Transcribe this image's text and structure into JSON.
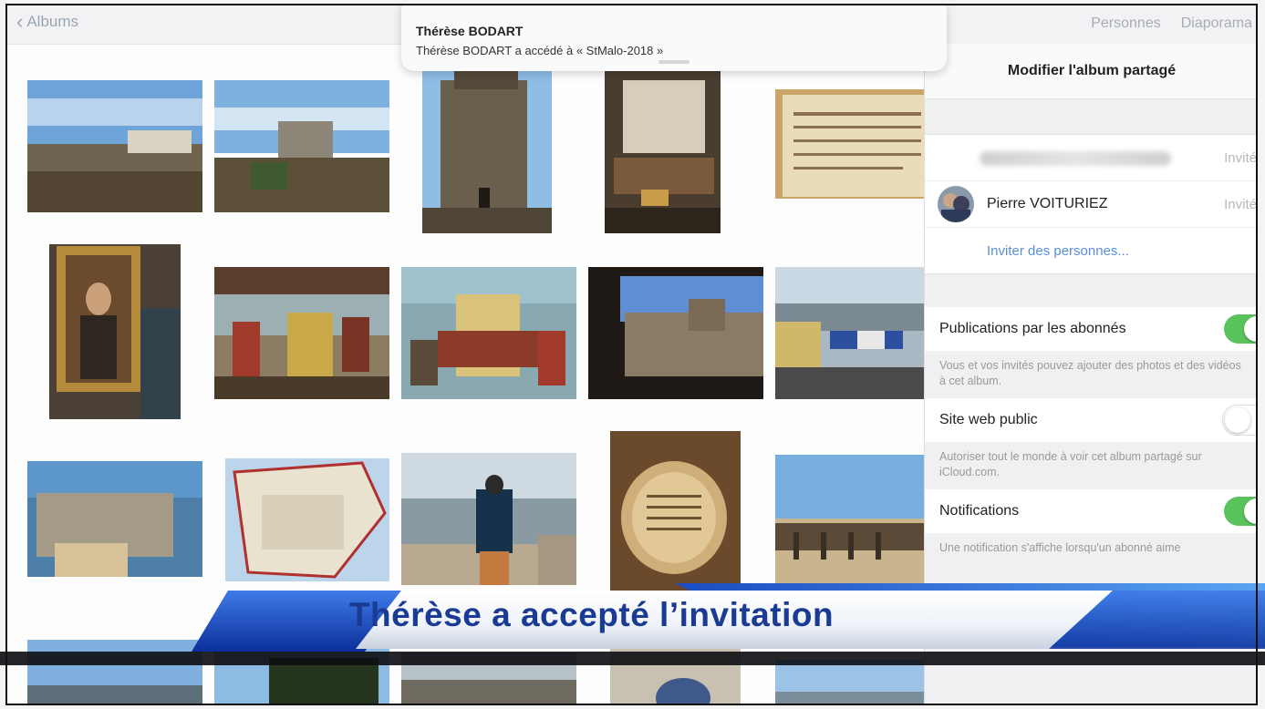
{
  "nav": {
    "back_label": "Albums",
    "right_items": [
      "Personnes",
      "Diaporama"
    ]
  },
  "notification": {
    "title": "Thérèse BODART",
    "body": "Thérèse BODART a accédé à « StMalo-2018 »"
  },
  "panel": {
    "title": "Modifier l'album partagé",
    "people": [
      {
        "name": "",
        "status": "Invité",
        "blurred": true
      },
      {
        "name": "Pierre VOITURIEZ",
        "status": "Invité"
      }
    ],
    "invite_link": "Inviter des personnes...",
    "settings": [
      {
        "label": "Publications par les abonnés",
        "on": true,
        "description": "Vous et vos invités pouvez ajouter des photos et des vidéos à cet album."
      },
      {
        "label": "Site web public",
        "on": false,
        "description": "Autoriser tout le monde à voir cet album partagé sur iCloud.com."
      },
      {
        "label": "Notifications",
        "on": true,
        "description": "Une notification s'affiche lorsqu'un abonné aime"
      }
    ]
  },
  "overlay": {
    "caption": "Thérèse a accepté l’invitation"
  },
  "colors": {
    "accent_blue": "#1a3b93",
    "toggle_green": "#5ac35e",
    "link_blue": "#5a8fd8"
  }
}
